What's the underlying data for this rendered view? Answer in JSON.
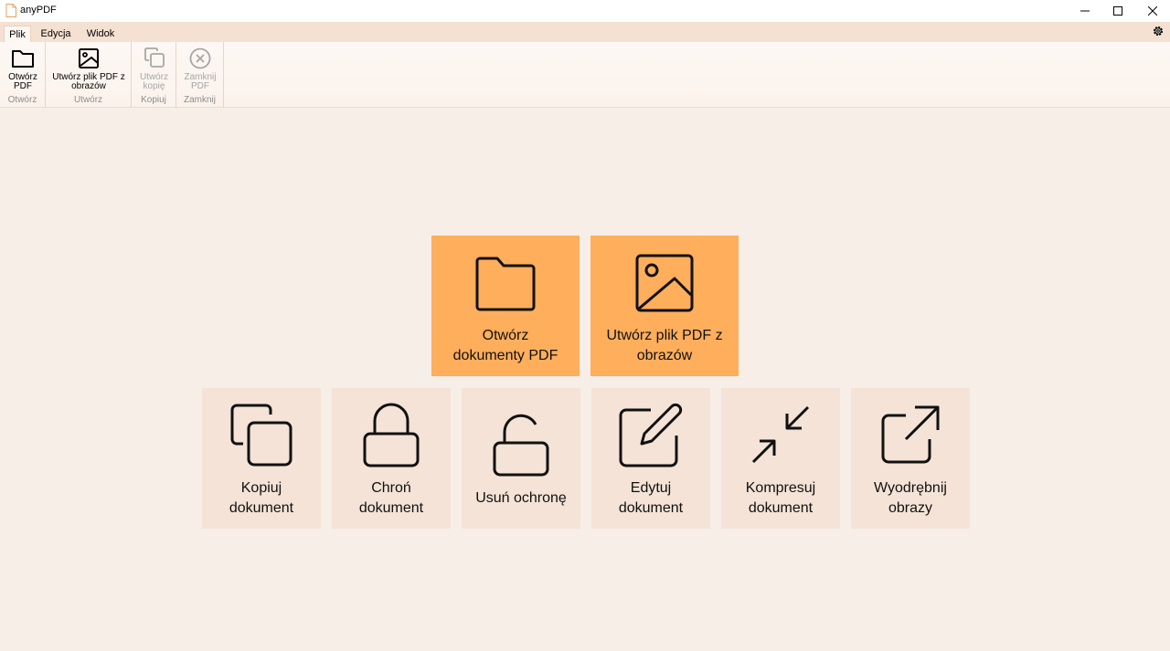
{
  "window": {
    "title": "anyPDF"
  },
  "tabs": [
    {
      "label": "Plik",
      "active": true
    },
    {
      "label": "Edycja",
      "active": false
    },
    {
      "label": "Widok",
      "active": false
    }
  ],
  "ribbon": {
    "groups": [
      {
        "label": "Otwórz",
        "button": {
          "label": "Otwórz\nPDF",
          "icon": "folder-icon",
          "enabled": true
        }
      },
      {
        "label": "Utwórz",
        "button": {
          "label": "Utwórz plik PDF z\nobrazów",
          "icon": "image-icon",
          "enabled": true
        }
      },
      {
        "label": "Kopiuj",
        "button": {
          "label": "Utwórz\nkopię",
          "icon": "copy-icon",
          "enabled": false
        }
      },
      {
        "label": "Zamknij",
        "button": {
          "label": "Zamknij\nPDF",
          "icon": "close-circle-icon",
          "enabled": false
        }
      }
    ]
  },
  "tiles": {
    "primary": [
      {
        "label": "Otwórz\ndokumenty PDF",
        "icon": "folder-icon"
      },
      {
        "label": "Utwórz plik PDF z\nobrazów",
        "icon": "image-icon"
      }
    ],
    "secondary": [
      {
        "label": "Kopiuj\ndokument",
        "icon": "copy-icon"
      },
      {
        "label": "Chroń\ndokument",
        "icon": "lock-icon"
      },
      {
        "label": "Usuń ochronę",
        "icon": "unlock-icon"
      },
      {
        "label": "Edytuj\ndokument",
        "icon": "edit-icon"
      },
      {
        "label": "Kompresuj\ndokument",
        "icon": "compress-icon"
      },
      {
        "label": "Wyodrębnij\nobrazy",
        "icon": "external-link-icon"
      }
    ]
  },
  "colors": {
    "primary_tile": "#ffae5c",
    "secondary_tile": "#f4e3d6",
    "background": "#f7eee8",
    "tab_bar": "#f4e1d2"
  }
}
